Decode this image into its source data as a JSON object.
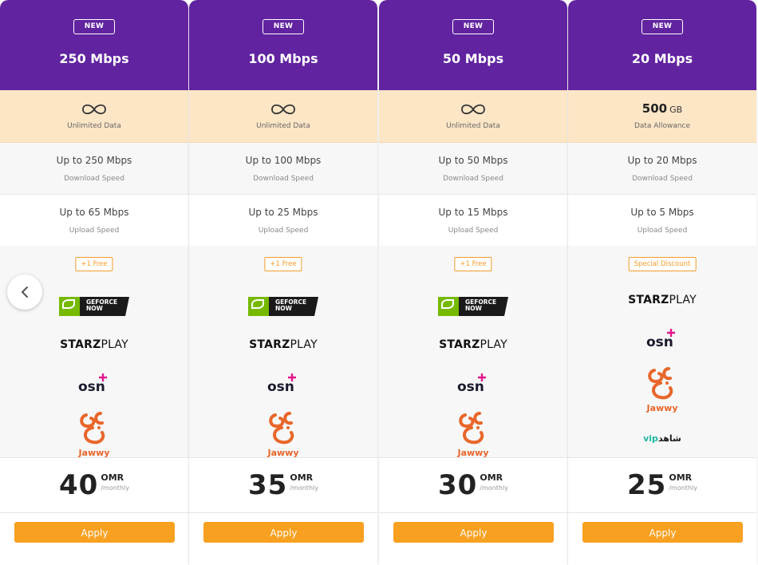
{
  "plans": [
    {
      "badge": "NEW",
      "speed": "250 Mbps",
      "data_label": "Unlimited Data",
      "download_value": "Up to 250 Mbps",
      "download_label": "Download Speed",
      "upload_value": "Up to 65 Mbps",
      "upload_label": "Upload Speed",
      "perk_tag": "+1 Free",
      "price": "40",
      "currency": "OMR",
      "period": "/monthly",
      "apply_label": "Apply"
    },
    {
      "badge": "NEW",
      "speed": "100 Mbps",
      "data_label": "Unlimited Data",
      "download_value": "Up to 100 Mbps",
      "download_label": "Download Speed",
      "upload_value": "Up to 25 Mbps",
      "upload_label": "Upload Speed",
      "perk_tag": "+1 Free",
      "price": "35",
      "currency": "OMR",
      "period": "/monthly",
      "apply_label": "Apply"
    },
    {
      "badge": "NEW",
      "speed": "50 Mbps",
      "data_label": "Unlimited Data",
      "download_value": "Up to 50 Mbps",
      "download_label": "Download Speed",
      "upload_value": "Up to 15 Mbps",
      "upload_label": "Upload Speed",
      "perk_tag": "+1 Free",
      "price": "30",
      "currency": "OMR",
      "period": "/monthly",
      "apply_label": "Apply"
    },
    {
      "badge": "NEW",
      "speed": "20 Mbps",
      "data_amount": "500",
      "data_unit": "GB",
      "data_label": "Data Allowance",
      "download_value": "Up to 20 Mbps",
      "download_label": "Download Speed",
      "upload_value": "Up to 5 Mbps",
      "upload_label": "Upload Speed",
      "perk_tag": "Special Discount",
      "price": "25",
      "currency": "OMR",
      "period": "/monthly",
      "apply_label": "Apply"
    }
  ],
  "logos": {
    "geforce_line1": "GEFORCE",
    "geforce_line2": "NOW",
    "starz_bold": "STARZ",
    "starz_light": "PLAY",
    "osn": "osn",
    "jawwy": "Jawwy",
    "shahid_vip": "vip",
    "shahid_ar": "شاهد"
  },
  "icons": {
    "unlimited": "infinity-icon",
    "prev": "chevron-left-icon"
  },
  "colors": {
    "header_purple": "#6123a0",
    "data_peach": "#fde6c6",
    "accent_orange": "#f8a01f",
    "geforce_green": "#76b900",
    "osn_pink": "#e2168c",
    "jawwy_orange": "#e8662a"
  }
}
